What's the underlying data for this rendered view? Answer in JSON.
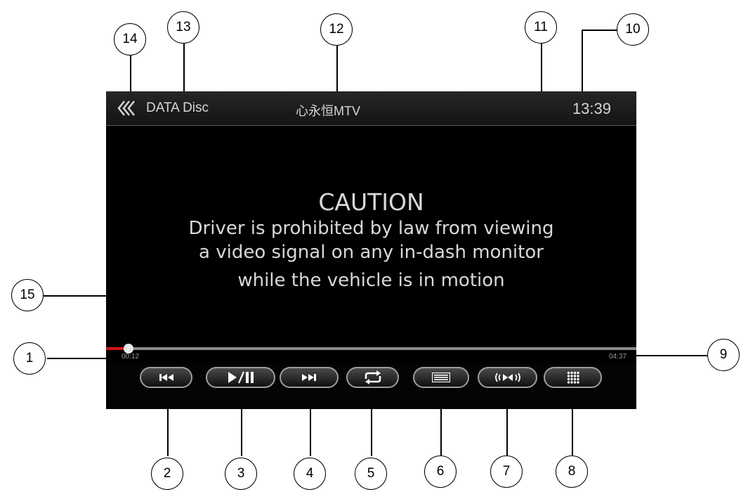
{
  "header": {
    "source_label": "DATA Disc",
    "track_title": "心永恒MTV",
    "clock": "13:39"
  },
  "caution": {
    "title": "CAUTION",
    "line1": "Driver is prohibited by law from viewing",
    "line2": "a video signal on any in-dash monitor",
    "line3": "while the vehicle is in motion"
  },
  "playback": {
    "elapsed": "00:12",
    "total": "04:37",
    "progress_fraction": 0.043
  },
  "controls": [
    "previous-track",
    "play-pause",
    "next-track",
    "repeat",
    "playlist",
    "audio-channel",
    "menu"
  ],
  "callouts": [
    "1",
    "2",
    "3",
    "4",
    "5",
    "6",
    "7",
    "8",
    "9",
    "10",
    "11",
    "12",
    "13",
    "14",
    "15"
  ],
  "colors": {
    "progress": "#d01515",
    "screen_bg": "#000000",
    "text": "#d6d6d6"
  }
}
